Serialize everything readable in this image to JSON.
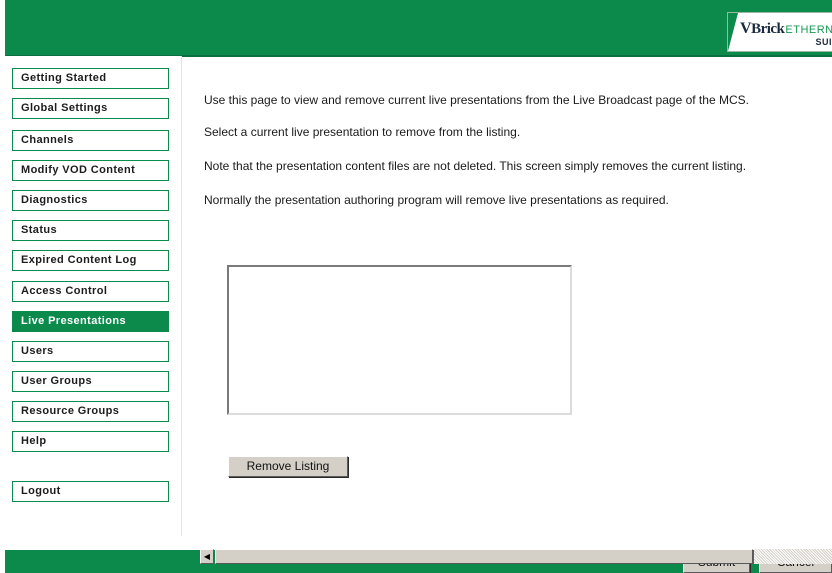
{
  "header": {
    "logo": {
      "brand_v": "V",
      "brand_rest": "Brick",
      "product": "ETHERNE",
      "sub": "SUI"
    }
  },
  "sidebar": {
    "items": [
      {
        "label": "Getting Started",
        "active": false
      },
      {
        "label": "Global Settings",
        "active": false
      },
      {
        "label": "Channels",
        "active": false
      },
      {
        "label": "Modify VOD Content",
        "active": false
      },
      {
        "label": "Diagnostics",
        "active": false
      },
      {
        "label": "Status",
        "active": false
      },
      {
        "label": "Expired Content Log",
        "active": false
      },
      {
        "label": "Access Control",
        "active": false
      },
      {
        "label": "Live Presentations",
        "active": true
      },
      {
        "label": "Users",
        "active": false
      },
      {
        "label": "User Groups",
        "active": false
      },
      {
        "label": "Resource Groups",
        "active": false
      },
      {
        "label": "Help",
        "active": false
      }
    ],
    "logout_label": "Logout"
  },
  "main": {
    "paragraphs": [
      "Use this page to view and remove current live presentations from the Live Broadcast page of the MCS.",
      "Select a current live presentation to remove from the listing.",
      "Note that the presentation content files are not deleted. This screen simply removes the current listing.",
      "Normally the presentation authoring program will remove live presentations as required."
    ],
    "remove_button_label": "Remove Listing"
  },
  "footer": {
    "submit_label": "Submit",
    "cancel_label": "Cancel"
  },
  "colors": {
    "brand_green": "#0b8a4c",
    "button_face": "#d4d0c8"
  }
}
